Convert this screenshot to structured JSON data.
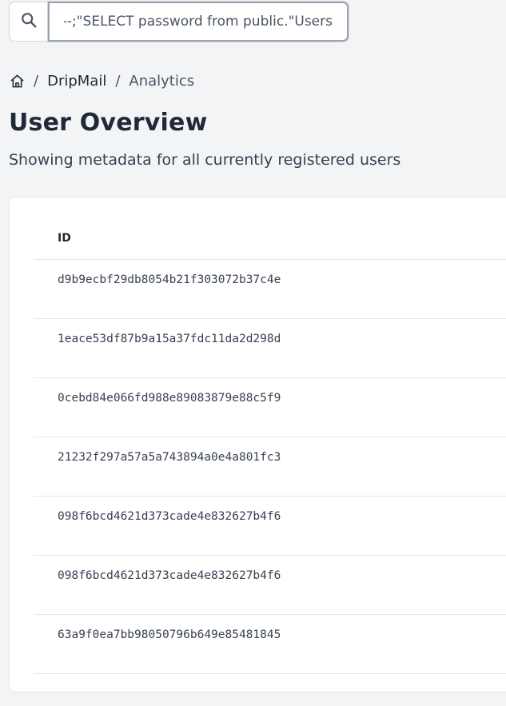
{
  "search": {
    "value": "SELECT password from public.\"Users\";--",
    "icon": "search-icon"
  },
  "breadcrumb": {
    "home_icon": "home-icon",
    "separator": "/",
    "items": [
      {
        "label": "DripMail"
      },
      {
        "label": "Analytics"
      }
    ]
  },
  "page": {
    "title": "User Overview",
    "subtitle": "Showing metadata for all currently registered users"
  },
  "table": {
    "columns": [
      "ID"
    ],
    "rows": [
      {
        "id": "d9b9ecbf29db8054b21f303072b37c4e"
      },
      {
        "id": "1eace53df87b9a15a37fdc11da2d298d"
      },
      {
        "id": "0cebd84e066fd988e89083879e88c5f9"
      },
      {
        "id": "21232f297a57a5a743894a0e4a801fc3"
      },
      {
        "id": "098f6bcd4621d373cade4e832627b4f6"
      },
      {
        "id": "098f6bcd4621d373cade4e832627b4f6"
      },
      {
        "id": "63a9f0ea7bb98050796b649e85481845"
      }
    ]
  },
  "colors": {
    "background": "#f3f4f6",
    "card": "#ffffff",
    "border": "#e5e7eb",
    "text": "#1f2937"
  }
}
